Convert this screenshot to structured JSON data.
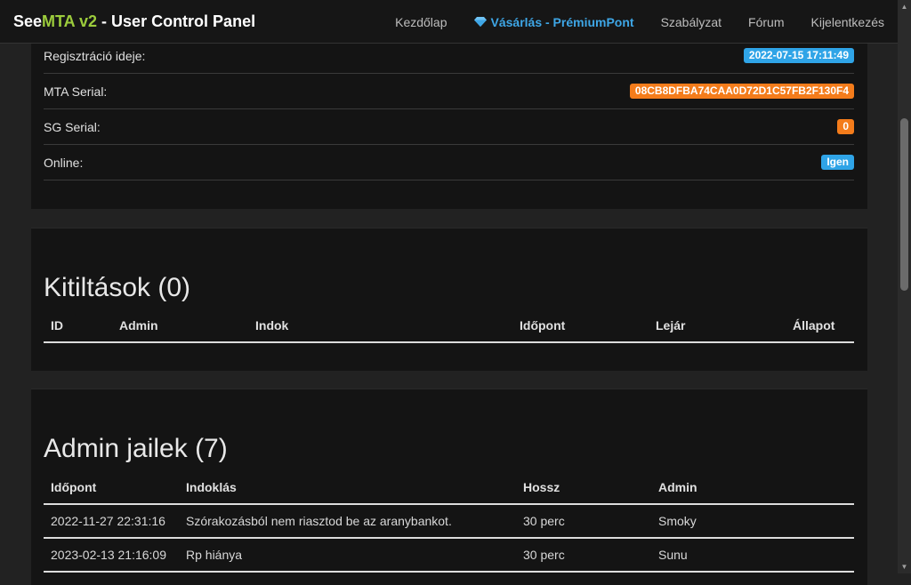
{
  "navbar": {
    "brand": {
      "see": "See",
      "mta": "MTA v2",
      "rest": " - User Control Panel"
    },
    "items": [
      {
        "label": "Kezdőlap"
      },
      {
        "label": "Vásárlás - PrémiumPont",
        "icon": "diamond-icon"
      },
      {
        "label": "Szabályzat"
      },
      {
        "label": "Fórum"
      },
      {
        "label": "Kijelentkezés"
      }
    ]
  },
  "profile": {
    "rows": [
      {
        "label": "Regisztráció ideje:",
        "value": "2022-07-15 17:11:49",
        "badge_color": "#2fa4e7"
      },
      {
        "label": "MTA Serial:",
        "value": "08CB8DFBA74CAA0D72D1C57FB2F130F4",
        "badge_color": "#f47c1b"
      },
      {
        "label": "SG Serial:",
        "value": "0",
        "badge_color": "#f47c1b"
      },
      {
        "label": "Online:",
        "value": "Igen",
        "badge_color": "#2fa4e7"
      }
    ]
  },
  "bans": {
    "title": "Kitiltások (0)",
    "columns": [
      "ID",
      "Admin",
      "Indok",
      "Időpont",
      "Lejár",
      "Állapot"
    ],
    "rows": []
  },
  "jails": {
    "title": "Admin jailek (7)",
    "columns": [
      "Időpont",
      "Indoklás",
      "Hossz",
      "Admin"
    ],
    "rows": [
      [
        "2022-11-27 22:31:16",
        "Szórakozásból nem riasztod be az aranybankot.",
        "30 perc",
        "Smoky"
      ],
      [
        "2023-02-13 21:16:09",
        "Rp hiánya",
        "30 perc",
        "Sunu"
      ]
    ]
  },
  "colors": {
    "accent_green": "#9ccc3c",
    "accent_blue": "#2fa4e7",
    "accent_orange": "#f47c1b"
  }
}
